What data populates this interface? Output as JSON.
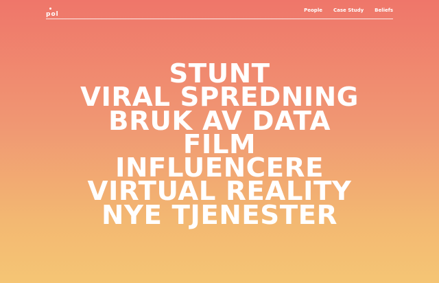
{
  "header": {
    "logo_text": "pol",
    "nav": [
      {
        "label": "People"
      },
      {
        "label": "Case Study"
      },
      {
        "label": "Beliefs"
      }
    ]
  },
  "hero": {
    "lines": [
      "STUNT",
      "VIRAL SPREDNING",
      "BRUK AV DATA",
      "FILM",
      "INFLUENCERE",
      "VIRTUAL REALITY",
      "NYE TJENESTER"
    ]
  },
  "colors": {
    "gradient_top": "#EF766A",
    "gradient_middle": "#F09873",
    "gradient_bottom": "#F5C574",
    "text": "#FFFFFF"
  }
}
